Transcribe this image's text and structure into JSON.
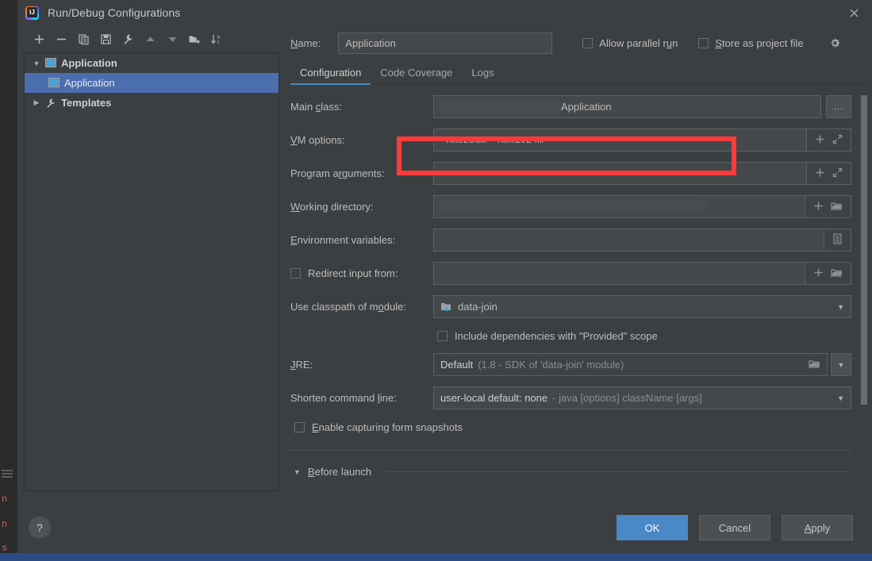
{
  "window": {
    "title": "Run/Debug Configurations",
    "logo_icon": "intellij-idea-logo-icon",
    "close_icon": "close-icon"
  },
  "tree_toolbar": {
    "buttons": [
      {
        "name": "add-configuration-button",
        "icon": "plus-icon"
      },
      {
        "name": "remove-configuration-button",
        "icon": "minus-icon"
      },
      {
        "name": "copy-configuration-button",
        "icon": "copy-icon"
      },
      {
        "name": "save-configuration-button",
        "icon": "save-icon"
      },
      {
        "name": "edit-templates-button",
        "icon": "wrench-icon"
      },
      {
        "name": "move-up-button",
        "icon": "arrow-up-icon"
      },
      {
        "name": "move-down-button",
        "icon": "arrow-down-icon"
      },
      {
        "name": "create-folder-button",
        "icon": "folder-add-icon"
      },
      {
        "name": "sort-configurations-button",
        "icon": "sort-az-icon"
      }
    ]
  },
  "tree": {
    "items": [
      {
        "label": "Application",
        "icon": "application-group-icon",
        "twisty": "▼",
        "level": 0,
        "bold": true,
        "selected": false
      },
      {
        "label": "Application",
        "icon": "application-icon",
        "twisty": "",
        "level": 1,
        "bold": false,
        "selected": true
      },
      {
        "label": "Templates",
        "icon": "wrench-icon",
        "twisty": "▶",
        "level": 0,
        "bold": true,
        "selected": false
      }
    ]
  },
  "name_row": {
    "label": "Name:",
    "label_mnemonic": "N",
    "value": "Application",
    "allow_parallel_run": {
      "label_before": "Allow parallel r",
      "mnemonic": "u",
      "label_after": "n",
      "checked": false
    },
    "store_as_project_file": {
      "mnemonic": "S",
      "label_after": "tore as project file",
      "checked": false
    },
    "gear_icon": "gear-icon"
  },
  "tabs": [
    {
      "label": "Configuration",
      "active": true
    },
    {
      "label": "Code Coverage",
      "active": false
    },
    {
      "label": "Logs",
      "active": false
    }
  ],
  "form": {
    "main_class": {
      "label_before": "Main ",
      "mnemonic": "c",
      "label_after": "lass:",
      "value": "Application",
      "redacted": true,
      "browse_label": "...",
      "browse_icon": "ellipsis-icon"
    },
    "vm_options": {
      "mnemonic": "V",
      "label_after": "M options:",
      "value": "–Xms256m –Xmx1024m",
      "insert_icon": "plus-icon",
      "expand_icon": "expand-icon",
      "highlighted": true
    },
    "program_arguments": {
      "label_before": "Program a",
      "mnemonic": "r",
      "label_after": "guments:",
      "value": "",
      "insert_icon": "plus-icon",
      "expand_icon": "expand-icon"
    },
    "working_directory": {
      "mnemonic": "W",
      "label_after": "orking directory:",
      "value": "",
      "redacted": true,
      "insert_icon": "plus-icon",
      "browse_icon": "folder-icon"
    },
    "environment_variables": {
      "mnemonic": "E",
      "label_after": "nvironment variables:",
      "value": "",
      "browse_icon": "list-icon"
    },
    "redirect_input": {
      "label": "Redirect input from:",
      "checked": false,
      "value": "",
      "insert_icon": "plus-icon",
      "browse_icon": "folder-icon"
    },
    "classpath_module": {
      "label_before": "Use classpath of m",
      "mnemonic": "o",
      "label_after": "dule:",
      "value": "data-join",
      "icon": "module-icon",
      "arrow_icon": "chevron-down-icon"
    },
    "include_provided": {
      "label": "Include dependencies with \"Provided\" scope",
      "checked": false
    },
    "jre": {
      "mnemonic": "J",
      "label_after": "RE:",
      "value_strong": "Default",
      "value_dim": "(1.8 - SDK of 'data-join' module)",
      "browse_icon": "folder-icon",
      "arrow_icon": "chevron-down-icon"
    },
    "shorten_command_line": {
      "label_before": "Shorten command ",
      "mnemonic": "l",
      "label_after": "ine:",
      "value_strong": "user-local default: none",
      "value_dim": "- java [options] className [args]",
      "arrow_icon": "chevron-down-icon"
    },
    "form_snapshots": {
      "mnemonic": "E",
      "label_after": "nable capturing form snapshots",
      "checked": false
    },
    "before_launch": {
      "mnemonic": "B",
      "label_after": "efore launch",
      "twisty": "▼"
    }
  },
  "footer": {
    "help_label": "?",
    "help_icon": "help-icon",
    "ok_label": "OK",
    "cancel_label": "Cancel",
    "apply_label_mnemonic": "A",
    "apply_label_after": "pply"
  },
  "background_ide": {
    "code_fragments": [
      "n",
      "n",
      "s"
    ]
  },
  "colors": {
    "dialog_bg": "#3c3f41",
    "field_bg": "#45484a",
    "accent_blue": "#4a88c7",
    "selection_blue": "#4b6eaf",
    "annotation_red": "#fc3b3b",
    "taskbar_blue": "#2d4b85"
  }
}
